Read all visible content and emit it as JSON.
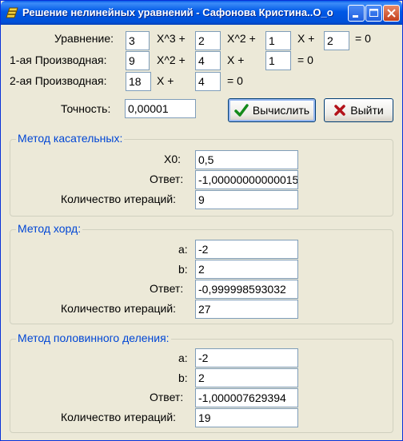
{
  "window": {
    "title": "Решение нелинейных уравнений - Сафонова Кристина..О_о",
    "icon": "delphi-helmet-icon"
  },
  "equation": {
    "label": "Уравнение:",
    "a": "3",
    "t1": "X^3 +",
    "b": "2",
    "t2": "X^2 +",
    "c": "1",
    "t3": "X +",
    "d": "2",
    "t4": "= 0"
  },
  "derivative1": {
    "label": "1-ая Производная:",
    "a": "9",
    "t1": "X^2 +",
    "b": "4",
    "t2": "X +",
    "c": "1",
    "t3": "= 0"
  },
  "derivative2": {
    "label": "2-ая Производная:",
    "a": "18",
    "t1": "X +",
    "b": "4",
    "t2": "= 0"
  },
  "precision": {
    "label": "Точность:",
    "value": "0,00001"
  },
  "buttons": {
    "compute": "Вычислить",
    "exit": "Выйти"
  },
  "tangent": {
    "caption": "Метод касательных:",
    "x0_label": "X0:",
    "x0": "0,5",
    "answer_label": "Ответ:",
    "answer": "-1,00000000000015",
    "iter_label": "Количество итераций:",
    "iter": "9"
  },
  "chord": {
    "caption": "Метод хорд:",
    "a_label": "a:",
    "a": "-2",
    "b_label": "b:",
    "b": "2",
    "answer_label": "Ответ:",
    "answer": "-0,999998593032",
    "iter_label": "Количество итераций:",
    "iter": "27"
  },
  "bisection": {
    "caption": "Метод половинного деления:",
    "a_label": "a:",
    "a": "-2",
    "b_label": "b:",
    "b": "2",
    "answer_label": "Ответ:",
    "answer": "-1,000007629394",
    "iter_label": "Количество итераций:",
    "iter": "19"
  }
}
